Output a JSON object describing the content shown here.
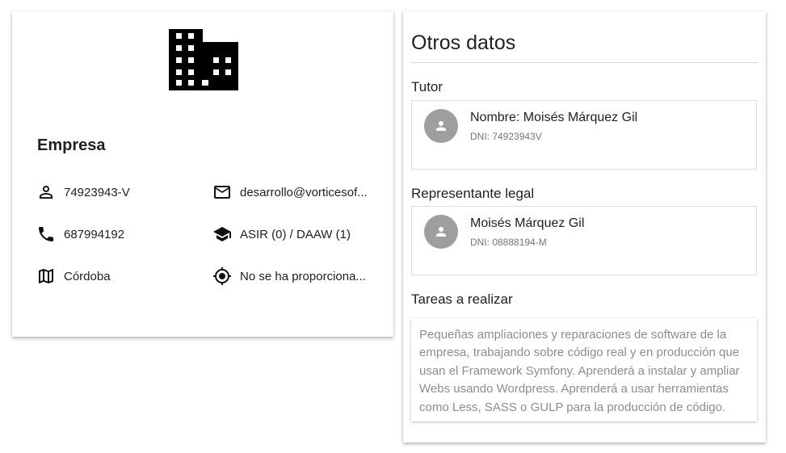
{
  "company": {
    "title": "Empresa",
    "icon": "office-building-icon",
    "dni": "74923943-V",
    "email": "desarrollo@vorticesof...",
    "phone": "687994192",
    "courses": "ASIR (0) / DAAW (1)",
    "city": "Córdoba",
    "location": "No se ha proporciona..."
  },
  "other": {
    "title": "Otros datos",
    "tutor": {
      "heading": "Tutor",
      "name": "Nombre: Moisés Márquez Gil",
      "dni": "DNI: 74923943V"
    },
    "legal": {
      "heading": "Representante legal",
      "name": "Moisés Márquez Gil",
      "dni": "DNI: 08888194-M"
    },
    "tasks": {
      "heading": "Tareas a realizar",
      "text": "Pequeñas ampliaciones y reparaciones de software de la empresa, trabajando sobre código real y en producción que usan el Framework Symfony. Aprenderá a instalar y ampliar Webs usando Wordpress. Aprenderá a usar herramientas como Less, SASS o GULP para la producción de código."
    }
  },
  "colors": {
    "icon": "#111111",
    "avatar": "#9e9e9e",
    "muted": "#8d8d8d"
  }
}
